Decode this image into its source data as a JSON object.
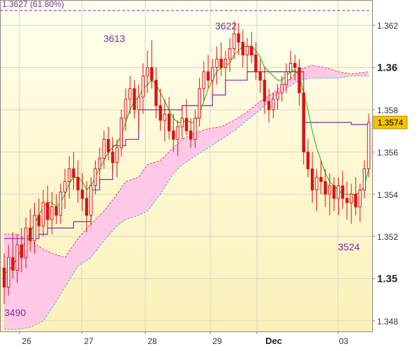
{
  "chart_data": {
    "type": "candlestick",
    "y_range": [
      1.3475,
      1.3632
    ],
    "y_ticks": [
      {
        "value": 1.348,
        "label": "1.348",
        "major": false
      },
      {
        "value": 1.35,
        "label": "1.35",
        "major": true
      },
      {
        "value": 1.352,
        "label": "1.352",
        "major": false
      },
      {
        "value": 1.354,
        "label": "1.354",
        "major": false
      },
      {
        "value": 1.356,
        "label": "1.356",
        "major": false
      },
      {
        "value": 1.358,
        "label": "1.358",
        "major": false
      },
      {
        "value": 1.36,
        "label": "1.36",
        "major": true
      },
      {
        "value": 1.362,
        "label": "1.362",
        "major": false
      }
    ],
    "x_ticks": [
      {
        "label": "26",
        "bold": false
      },
      {
        "label": "27",
        "bold": false
      },
      {
        "label": "28",
        "bold": false
      },
      {
        "label": "29",
        "bold": false
      },
      {
        "label": "Dec",
        "bold": true
      },
      {
        "label": "03",
        "bold": false
      }
    ],
    "fib_level": {
      "value": 1.3627,
      "label": "1.3627 (61.80%)"
    },
    "current_price": {
      "value": 1.3574,
      "label": "1.3574"
    },
    "annotations": [
      {
        "label": "3490",
        "value": 1.349
      },
      {
        "label": "3613",
        "value": 1.3613
      },
      {
        "label": "3622",
        "value": 1.3622
      },
      {
        "label": "3524",
        "value": 1.3524
      }
    ],
    "colors": {
      "candle": "#dd1111",
      "cloud_fill": "#ffc8e6",
      "cloud_edge_top": "#e0407a",
      "cloud_edge_bottom": "#30c0d0",
      "tenkan": "#22c822",
      "kijun": "#7a2fa8",
      "fib_line": "#7a2fa8",
      "price_tag": "#f5c400",
      "background_top": "#ffffee",
      "background_bottom": "#fdf3c0"
    },
    "candles": [
      [
        1.3505,
        1.3512,
        1.3488,
        1.3496
      ],
      [
        1.3496,
        1.3516,
        1.3492,
        1.351
      ],
      [
        1.351,
        1.3522,
        1.35,
        1.3504
      ],
      [
        1.3504,
        1.3521,
        1.3498,
        1.3516
      ],
      [
        1.3516,
        1.3524,
        1.3503,
        1.351
      ],
      [
        1.351,
        1.3529,
        1.3505,
        1.3524
      ],
      [
        1.3524,
        1.3533,
        1.3513,
        1.3518
      ],
      [
        1.3518,
        1.3536,
        1.3512,
        1.353
      ],
      [
        1.353,
        1.3538,
        1.352,
        1.3525
      ],
      [
        1.3525,
        1.3542,
        1.352,
        1.3536
      ],
      [
        1.3536,
        1.3544,
        1.3524,
        1.3528
      ],
      [
        1.3528,
        1.3541,
        1.3521,
        1.3534
      ],
      [
        1.3534,
        1.354,
        1.3526,
        1.353
      ],
      [
        1.353,
        1.3545,
        1.3526,
        1.3541
      ],
      [
        1.3541,
        1.3552,
        1.3533,
        1.3546
      ],
      [
        1.3546,
        1.3558,
        1.3538,
        1.3552
      ],
      [
        1.3552,
        1.356,
        1.3542,
        1.3548
      ],
      [
        1.3548,
        1.3556,
        1.3536,
        1.3542
      ],
      [
        1.3542,
        1.355,
        1.3532,
        1.3538
      ],
      [
        1.3538,
        1.3546,
        1.3522,
        1.353
      ],
      [
        1.353,
        1.3548,
        1.3525,
        1.3544
      ],
      [
        1.3544,
        1.3556,
        1.354,
        1.3552
      ],
      [
        1.3552,
        1.3562,
        1.3546,
        1.3557
      ],
      [
        1.3557,
        1.357,
        1.3552,
        1.3566
      ],
      [
        1.3566,
        1.3572,
        1.3556,
        1.356
      ],
      [
        1.356,
        1.3567,
        1.355,
        1.3555
      ],
      [
        1.3555,
        1.3566,
        1.3548,
        1.3562
      ],
      [
        1.3562,
        1.358,
        1.3558,
        1.3576
      ],
      [
        1.3576,
        1.359,
        1.357,
        1.3585
      ],
      [
        1.3585,
        1.3596,
        1.3578,
        1.359
      ],
      [
        1.359,
        1.3594,
        1.3576,
        1.358
      ],
      [
        1.358,
        1.3592,
        1.357,
        1.3586
      ],
      [
        1.3586,
        1.3602,
        1.3578,
        1.3596
      ],
      [
        1.3596,
        1.3608,
        1.3588,
        1.36
      ],
      [
        1.36,
        1.3613,
        1.359,
        1.3594
      ],
      [
        1.3594,
        1.36,
        1.3576,
        1.3582
      ],
      [
        1.3582,
        1.359,
        1.357,
        1.3575
      ],
      [
        1.3575,
        1.3585,
        1.3565,
        1.3578
      ],
      [
        1.3578,
        1.3586,
        1.3566,
        1.357
      ],
      [
        1.357,
        1.3578,
        1.356,
        1.3566
      ],
      [
        1.3566,
        1.3575,
        1.3558,
        1.3572
      ],
      [
        1.3572,
        1.3582,
        1.3566,
        1.3576
      ],
      [
        1.3576,
        1.3585,
        1.3568,
        1.357
      ],
      [
        1.357,
        1.3576,
        1.3562,
        1.3566
      ],
      [
        1.3566,
        1.358,
        1.3562,
        1.3576
      ],
      [
        1.3576,
        1.3595,
        1.3572,
        1.359
      ],
      [
        1.359,
        1.3603,
        1.3584,
        1.3598
      ],
      [
        1.3598,
        1.3606,
        1.359,
        1.3594
      ],
      [
        1.3594,
        1.3604,
        1.3586,
        1.36
      ],
      [
        1.36,
        1.361,
        1.3592,
        1.3604
      ],
      [
        1.3604,
        1.3612,
        1.3596,
        1.36
      ],
      [
        1.36,
        1.3608,
        1.3592,
        1.3604
      ],
      [
        1.3604,
        1.3614,
        1.3598,
        1.3609
      ],
      [
        1.3609,
        1.3622,
        1.3604,
        1.3616
      ],
      [
        1.3616,
        1.3621,
        1.3606,
        1.3612
      ],
      [
        1.3612,
        1.3618,
        1.36,
        1.3606
      ],
      [
        1.3606,
        1.3614,
        1.3598,
        1.361
      ],
      [
        1.361,
        1.3617,
        1.3602,
        1.3606
      ],
      [
        1.3606,
        1.3612,
        1.3594,
        1.3598
      ],
      [
        1.3598,
        1.3604,
        1.3588,
        1.3594
      ],
      [
        1.3594,
        1.36,
        1.3578,
        1.3584
      ],
      [
        1.3584,
        1.359,
        1.3574,
        1.358
      ],
      [
        1.358,
        1.3588,
        1.3576,
        1.3585
      ],
      [
        1.3585,
        1.3592,
        1.358,
        1.3588
      ],
      [
        1.3588,
        1.3596,
        1.3584,
        1.3592
      ],
      [
        1.3592,
        1.3602,
        1.3588,
        1.3598
      ],
      [
        1.3598,
        1.3608,
        1.3594,
        1.3602
      ],
      [
        1.3602,
        1.3606,
        1.3594,
        1.36
      ],
      [
        1.36,
        1.3604,
        1.3582,
        1.3588
      ],
      [
        1.3588,
        1.359,
        1.3554,
        1.356
      ],
      [
        1.356,
        1.3566,
        1.3548,
        1.3552
      ],
      [
        1.3552,
        1.356,
        1.3536,
        1.3542
      ],
      [
        1.3542,
        1.3552,
        1.3532,
        1.3548
      ],
      [
        1.3548,
        1.3556,
        1.354,
        1.3546
      ],
      [
        1.3546,
        1.3552,
        1.3534,
        1.354
      ],
      [
        1.354,
        1.355,
        1.353,
        1.3544
      ],
      [
        1.3544,
        1.3548,
        1.3532,
        1.3538
      ],
      [
        1.3538,
        1.3548,
        1.353,
        1.3544
      ],
      [
        1.3544,
        1.3551,
        1.3533,
        1.3538
      ],
      [
        1.3538,
        1.3546,
        1.3528,
        1.3536
      ],
      [
        1.3536,
        1.3545,
        1.3526,
        1.354
      ],
      [
        1.354,
        1.3548,
        1.353,
        1.3534
      ],
      [
        1.3534,
        1.3545,
        1.3527,
        1.3542
      ],
      [
        1.3542,
        1.3556,
        1.3538,
        1.3552
      ],
      [
        1.3552,
        1.3578,
        1.3548,
        1.3574
      ]
    ],
    "tenkan": [
      1.3502,
      1.3504,
      1.3506,
      1.351,
      1.3514,
      1.3518,
      1.3522,
      1.3526,
      1.353,
      1.3534,
      1.3536,
      1.3536,
      1.3534,
      1.3536,
      1.354,
      1.3545,
      1.3548,
      1.3548,
      1.3546,
      1.3542,
      1.3544,
      1.3548,
      1.3552,
      1.3556,
      1.356,
      1.3562,
      1.3564,
      1.3568,
      1.3574,
      1.358,
      1.3584,
      1.3586,
      1.359,
      1.3592,
      1.3594,
      1.3592,
      1.3588,
      1.3584,
      1.358,
      1.3576,
      1.3574,
      1.3574,
      1.3575,
      1.3574,
      1.3574,
      1.3578,
      1.3584,
      1.359,
      1.3594,
      1.3598,
      1.36,
      1.3601,
      1.3602,
      1.3606,
      1.3608,
      1.361,
      1.361,
      1.361,
      1.3608,
      1.3605,
      1.36,
      1.3598,
      1.3596,
      1.3594,
      1.3594,
      1.3596,
      1.3598,
      1.3599,
      1.3596,
      1.3588,
      1.358,
      1.357,
      1.3562,
      1.3556,
      1.355,
      1.3546,
      1.3544,
      1.3542,
      1.354,
      1.354,
      1.354,
      1.354,
      1.3541,
      1.3544,
      1.3552
    ],
    "kijun": [
      1.3519,
      1.3519,
      1.3519,
      1.3519,
      1.3519,
      1.3519,
      1.3519,
      1.3519,
      1.3521,
      1.3521,
      1.3524,
      1.3524,
      1.3524,
      1.3524,
      1.3524,
      1.3524,
      1.3527,
      1.3527,
      1.3527,
      1.3527,
      1.3542,
      1.3542,
      1.3547,
      1.3547,
      1.3547,
      1.3563,
      1.3563,
      1.3563,
      1.3566,
      1.3566,
      1.3566,
      1.358,
      1.358,
      1.358,
      1.358,
      1.358,
      1.358,
      1.358,
      1.358,
      1.358,
      1.358,
      1.3582,
      1.3582,
      1.3582,
      1.3582,
      1.3582,
      1.3582,
      1.3582,
      1.3587,
      1.3587,
      1.3587,
      1.3594,
      1.3594,
      1.3594,
      1.3594,
      1.3594,
      1.3598,
      1.3598,
      1.3598,
      1.3598,
      1.3598,
      1.3598,
      1.3598,
      1.3598,
      1.3598,
      1.3598,
      1.3598,
      1.3598,
      1.3598,
      1.3574,
      1.3574,
      1.3574,
      1.3574,
      1.3574,
      1.3574,
      1.3574,
      1.3574,
      1.3574,
      1.3574,
      1.3574,
      1.3573,
      1.3573,
      1.3573,
      1.3573,
      1.3573
    ],
    "cloud_top": [
      1.3475,
      1.3475,
      1.3475,
      1.3475,
      1.3475,
      1.3475,
      1.3475,
      1.3475,
      1.3475,
      1.3475,
      1.3475,
      1.3475,
      1.3475,
      1.3475,
      1.3475,
      1.3475,
      1.3475,
      1.3475,
      1.3475,
      1.3475,
      1.3475,
      1.3475,
      1.3475,
      1.3475,
      1.3475,
      1.3475,
      1.3475,
      1.3475,
      1.3475,
      1.3475,
      1.3475,
      1.3475,
      1.3475,
      1.3475,
      1.3475,
      1.3475,
      1.3475,
      1.3475,
      1.3475,
      1.3475,
      1.3475,
      1.3475,
      1.3475,
      1.3475,
      1.3475,
      1.3475,
      1.3475,
      1.3475,
      1.3475,
      1.3475,
      1.3475,
      1.3475,
      1.3475,
      1.3475,
      1.3475,
      1.3475,
      1.3475,
      1.3475,
      1.3475,
      1.3475,
      1.3475,
      1.3475,
      1.3475,
      1.3475,
      1.3475,
      1.3475,
      1.3475,
      1.3475,
      1.3475,
      1.3475,
      1.3475,
      1.3475,
      1.3475,
      1.3475,
      1.3475,
      1.3475,
      1.3475,
      1.3475,
      1.3475,
      1.3475,
      1.3475,
      1.3475,
      1.3475,
      1.3475,
      1.3475
    ]
  }
}
